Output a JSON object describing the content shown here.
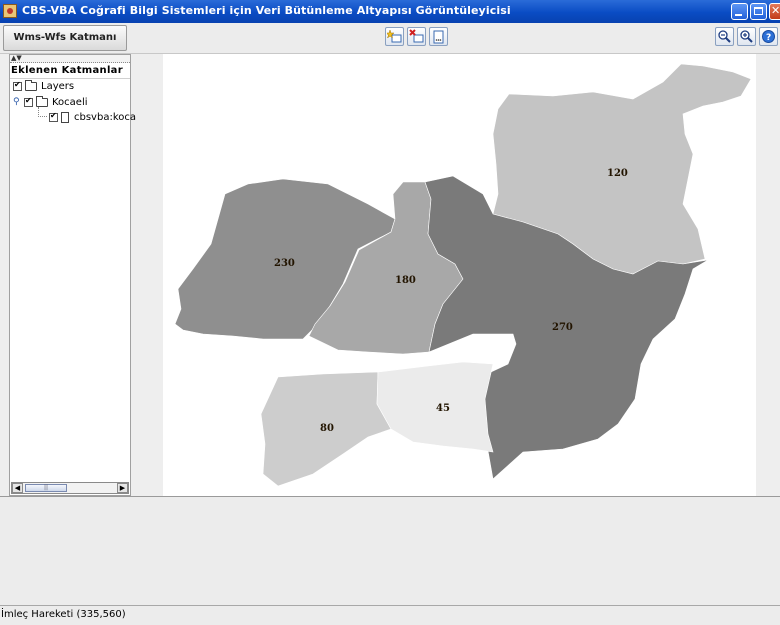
{
  "window": {
    "title": "CBS-VBA Coğrafi Bilgi Sistemleri için Veri Bütünleme Altyapısı Görüntüleyicisi"
  },
  "toolbar": {
    "add_wms_wfs_label": "Wms-Wfs Katmanı Ekle"
  },
  "sidebar": {
    "header": "Eklenen Katmanlar",
    "tree": [
      {
        "label": "Layers",
        "checked": true,
        "type": "folder"
      },
      {
        "label": "Kocaeli",
        "checked": true,
        "type": "folder"
      },
      {
        "label": "cbsvba:koca",
        "checked": true,
        "type": "file"
      }
    ],
    "scroll_thumb": "||"
  },
  "map": {
    "regions": [
      {
        "label": "120",
        "color": "#c4c4c4"
      },
      {
        "label": "230",
        "color": "#8f8f8f"
      },
      {
        "label": "180",
        "color": "#a8a8a8"
      },
      {
        "label": "270",
        "color": "#7a7a7a"
      },
      {
        "label": "80",
        "color": "#cdcdcd"
      },
      {
        "label": "45",
        "color": "#ebebeb"
      }
    ]
  },
  "status": {
    "text": "İmleç Hareketi (335,560)"
  },
  "icons": [
    "app-icon",
    "add-layer-icon",
    "remove-layer-icon",
    "properties-icon",
    "zoom-out-icon",
    "zoom-in-icon",
    "help-icon"
  ]
}
